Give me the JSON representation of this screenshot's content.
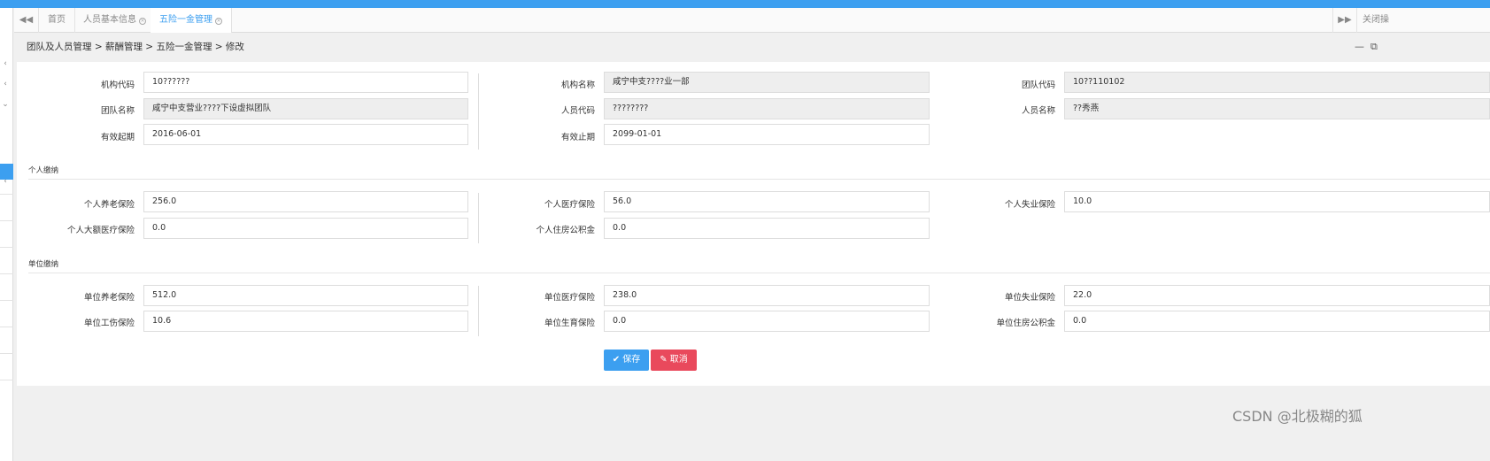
{
  "tabs": {
    "items": [
      {
        "label": "首页"
      },
      {
        "label": "人员基本信息"
      },
      {
        "label": "五险一金管理"
      }
    ],
    "close_all_label": "关闭操"
  },
  "breadcrumb": "团队及人员管理 > 薪酬管理 > 五险一金管理 > 修改",
  "basic": {
    "org_code": {
      "label": "机构代码",
      "value": "10??????"
    },
    "org_name": {
      "label": "机构名称",
      "value": "咸宁中支????业一部"
    },
    "team_code": {
      "label": "团队代码",
      "value": "10??110102"
    },
    "team_name": {
      "label": "团队名称",
      "value": "咸宁中支营业????下设虚拟团队"
    },
    "person_code": {
      "label": "人员代码",
      "value": "????????"
    },
    "person_name": {
      "label": "人员名称",
      "value": "??秀燕"
    },
    "valid_from": {
      "label": "有效起期",
      "value": "2016-06-01"
    },
    "valid_to": {
      "label": "有效止期",
      "value": "2099-01-01"
    }
  },
  "personal": {
    "title": "个人缴纳",
    "pension": {
      "label": "个人养老保险",
      "value": "256.0"
    },
    "medical": {
      "label": "个人医疗保险",
      "value": "56.0"
    },
    "unemployment": {
      "label": "个人失业保险",
      "value": "10.0"
    },
    "major_medical": {
      "label": "个人大额医疗保险",
      "value": "0.0"
    },
    "housing_fund": {
      "label": "个人住房公积金",
      "value": "0.0"
    }
  },
  "company": {
    "title": "单位缴纳",
    "pension": {
      "label": "单位养老保险",
      "value": "512.0"
    },
    "medical": {
      "label": "单位医疗保险",
      "value": "238.0"
    },
    "unemployment": {
      "label": "单位失业保险",
      "value": "22.0"
    },
    "injury": {
      "label": "单位工伤保险",
      "value": "10.6"
    },
    "maternity": {
      "label": "单位生育保险",
      "value": "0.0"
    },
    "housing_fund": {
      "label": "单位住房公积金",
      "value": "0.0"
    }
  },
  "buttons": {
    "save": "保存",
    "cancel": "取消"
  },
  "watermark": "CSDN @北极糊的狐",
  "colors": {
    "accent": "#3c9ff0",
    "danger": "#e9495c"
  }
}
